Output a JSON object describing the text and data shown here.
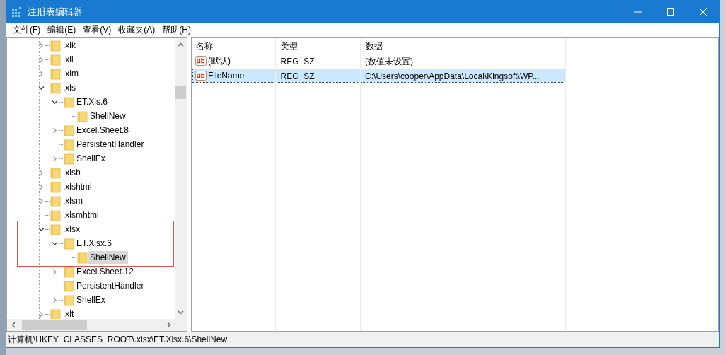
{
  "window": {
    "title": "注册表编辑器"
  },
  "menu": [
    "文件(F)",
    "编辑(E)",
    "查看(V)",
    "收藏夹(A)",
    "帮助(H)"
  ],
  "tree": [
    {
      "label": ".xlk",
      "expanded": false,
      "selected": false,
      "outlined": false
    },
    {
      "label": ".xll",
      "expanded": false,
      "selected": false,
      "outlined": false
    },
    {
      "label": ".xlm",
      "expanded": false,
      "selected": false,
      "outlined": false
    },
    {
      "label": ".xls",
      "expanded": true,
      "selected": false,
      "outlined": false,
      "children": [
        {
          "label": "ET.Xls.6",
          "expanded": true,
          "selected": false,
          "outlined": false,
          "children": [
            {
              "label": "ShellNew",
              "selected": false,
              "outlined": false
            }
          ]
        },
        {
          "label": "Excel.Sheet.8",
          "expanded": false,
          "selected": false,
          "outlined": false
        },
        {
          "label": "PersistentHandler",
          "selected": false,
          "outlined": false
        },
        {
          "label": "ShellEx",
          "expanded": false,
          "selected": false,
          "outlined": false
        }
      ]
    },
    {
      "label": ".xlsb",
      "expanded": false,
      "selected": false,
      "outlined": false
    },
    {
      "label": ".xlshtml",
      "expanded": false,
      "selected": false,
      "outlined": false
    },
    {
      "label": ".xlsm",
      "expanded": false,
      "selected": false,
      "outlined": false
    },
    {
      "label": ".xlsmhtml",
      "selected": false,
      "outlined": false
    },
    {
      "label": ".xlsx",
      "expanded": true,
      "selected": false,
      "outlined": true,
      "children": [
        {
          "label": "ET.Xlsx.6",
          "expanded": true,
          "selected": false,
          "outlined": true,
          "children": [
            {
              "label": "ShellNew",
              "selected": true,
              "outlined": true
            }
          ]
        },
        {
          "label": "Excel.Sheet.12",
          "expanded": false,
          "selected": false,
          "outlined": false
        },
        {
          "label": "PersistentHandler",
          "selected": false,
          "outlined": false
        },
        {
          "label": "ShellEx",
          "expanded": false,
          "selected": false,
          "outlined": false
        }
      ]
    },
    {
      "label": ".xlt",
      "expanded": false,
      "selected": false,
      "outlined": false
    }
  ],
  "table": {
    "columns": [
      "名称",
      "类型",
      "数据"
    ],
    "rows": [
      {
        "name": "(默认)",
        "type": "REG_SZ",
        "data": "(数值未设置)",
        "selected": false,
        "outlined": true
      },
      {
        "name": "FileName",
        "type": "REG_SZ",
        "data": "C:\\Users\\cooper\\AppData\\Local\\Kingsoft\\WP...",
        "selected": true,
        "outlined": true
      }
    ]
  },
  "status_bar": "计算机\\HKEY_CLASSES_ROOT\\.xlsx\\ET.Xlsx.6\\ShellNew"
}
